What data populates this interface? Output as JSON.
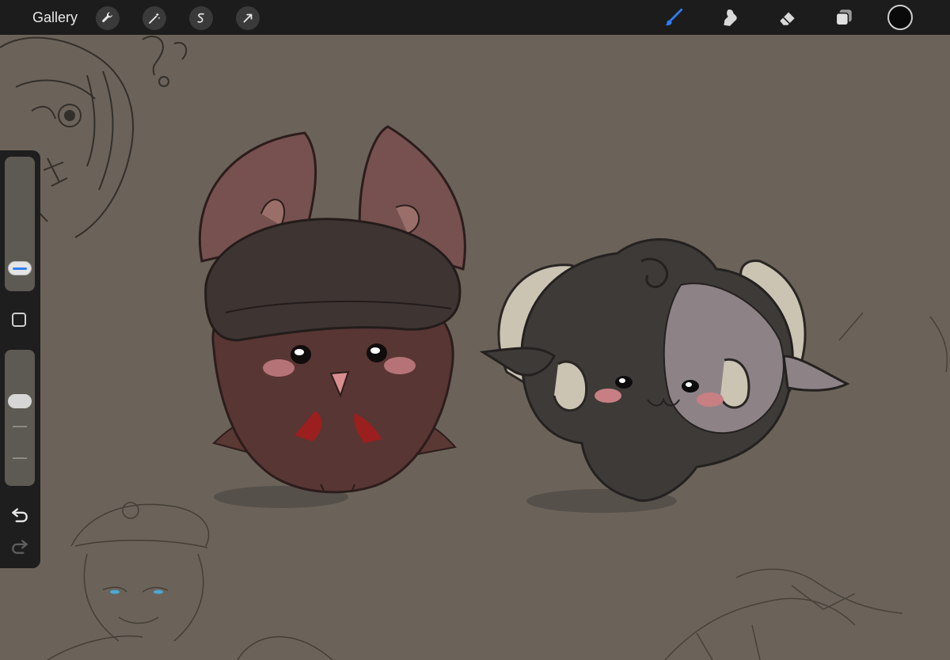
{
  "toolbar": {
    "gallery_label": "Gallery",
    "left_tools": [
      "wrench-icon",
      "magic-wand-icon",
      "selection-icon",
      "transform-arrow-icon"
    ],
    "right_tools": [
      "brush-icon",
      "smudge-icon",
      "eraser-icon",
      "layers-icon"
    ],
    "active_tool": "brush-icon",
    "active_color": "#0a0a0a",
    "accent_color": "#2f7ef5"
  },
  "sidebar": {
    "brush_size_level": 0.22,
    "opacity_level": 0.62,
    "controls": [
      "modify-square-icon",
      "undo-icon",
      "redo-icon"
    ]
  },
  "canvas": {
    "background_color": "#6b6359"
  }
}
